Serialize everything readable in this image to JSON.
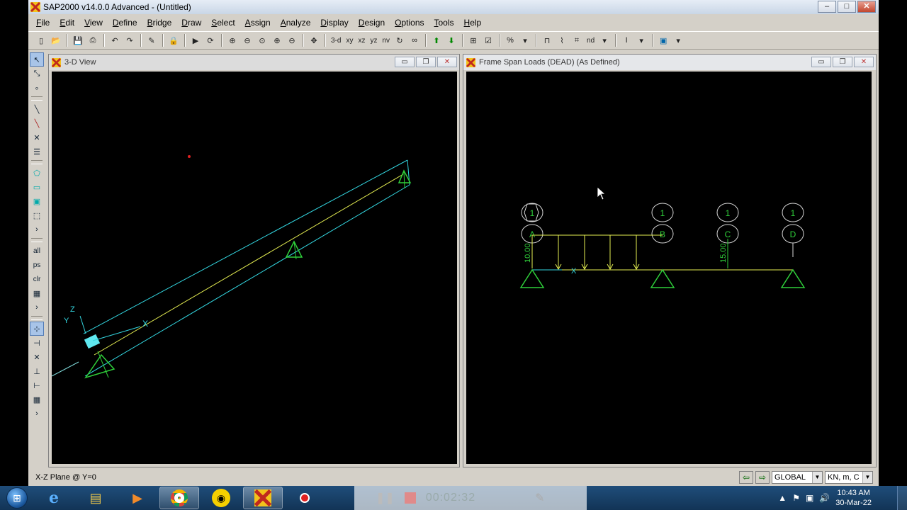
{
  "app": {
    "title": "SAP2000 v14.0.0 Advanced  - (Untitled)",
    "window_buttons": [
      "–",
      "□",
      "✕"
    ]
  },
  "menubar": [
    "File",
    "Edit",
    "View",
    "Define",
    "Bridge",
    "Draw",
    "Select",
    "Assign",
    "Analyze",
    "Display",
    "Design",
    "Options",
    "Tools",
    "Help"
  ],
  "toolbar": {
    "view_3d": "3-d",
    "view_xy": "xy",
    "view_xz": "xz",
    "view_yz": "yz",
    "view_nv": "nv",
    "nd": "nd"
  },
  "vtoolbar": {
    "all": "all",
    "ps": "ps",
    "clr": "clr"
  },
  "views": {
    "left": {
      "title": "3-D View",
      "axis_labels": {
        "x": "X",
        "y": "Y",
        "z": "Z"
      }
    },
    "right": {
      "title": "Frame Span Loads (DEAD) (As Defined)",
      "bubbles_top": [
        "1",
        "1",
        "1",
        "1"
      ],
      "bubbles_bottom": [
        "A",
        "B",
        "C",
        "D"
      ],
      "load_1": "10.00",
      "load_2": "15.00",
      "axis_x": "X"
    }
  },
  "status": {
    "text": "X-Z Plane @ Y=0",
    "coord_system": "GLOBAL",
    "units": "KN, m, C"
  },
  "taskbar": {
    "rec_timer": "00:02:32",
    "time": "10:43 AM",
    "date": "30-Mar-22"
  }
}
